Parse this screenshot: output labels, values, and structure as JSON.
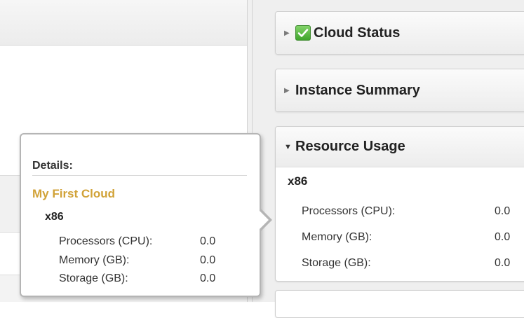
{
  "colors": {
    "cloud_name": "#D1A237",
    "check_green": "#3FA42C"
  },
  "sidebar": {
    "cloud_status": {
      "title": "Cloud Status",
      "expanded": false,
      "status_icon": "green-check-icon",
      "arrow_icon": "triangle-right-icon"
    },
    "instance_summary": {
      "title": "Instance Summary",
      "expanded": false,
      "arrow_icon": "triangle-right-icon"
    },
    "resource_usage": {
      "title": "Resource Usage",
      "expanded": true,
      "arrow_icon": "triangle-down-icon",
      "architecture": "x86",
      "rows": [
        {
          "label": "Processors (CPU):",
          "value": "0.0"
        },
        {
          "label": "Memory (GB):",
          "value": "0.0"
        },
        {
          "label": "Storage (GB):",
          "value": "0.0"
        }
      ]
    }
  },
  "popover": {
    "title": "Details:",
    "cloud_name": "My First Cloud",
    "architecture": "x86",
    "rows": [
      {
        "label": "Processors (CPU):",
        "value": "0.0"
      },
      {
        "label": "Memory (GB):",
        "value": "0.0"
      },
      {
        "label": "Storage (GB):",
        "value": "0.0"
      }
    ]
  }
}
